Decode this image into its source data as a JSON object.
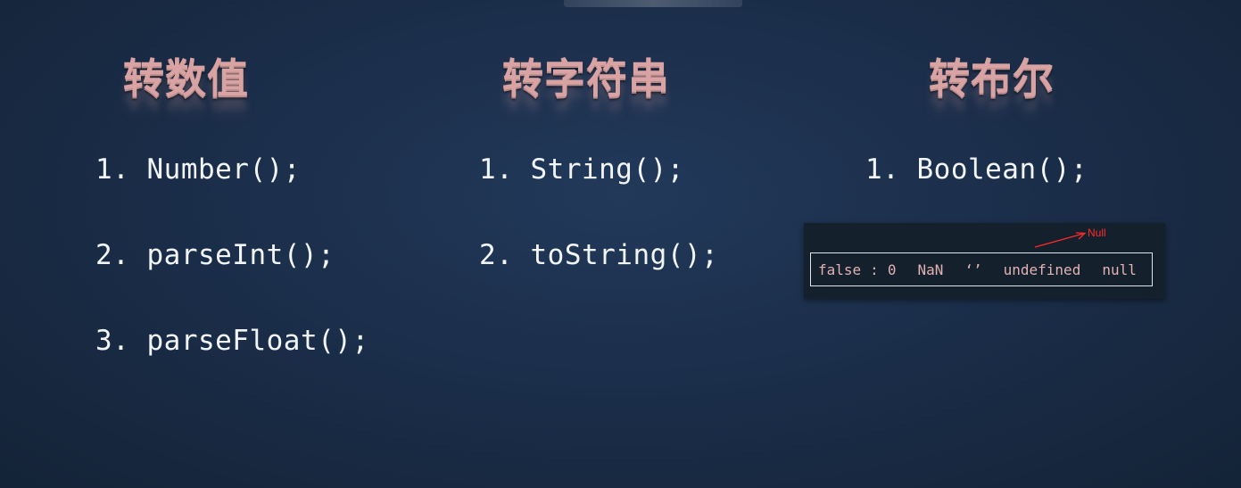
{
  "columns": [
    {
      "title": "转数值",
      "items": [
        "1. Number();",
        "2. parseInt();",
        "3. parseFloat();"
      ]
    },
    {
      "title": "转字符串",
      "items": [
        "1. String();",
        "2. toString();"
      ]
    },
    {
      "title": "转布尔",
      "items": [
        "1. Boolean();"
      ]
    }
  ],
  "falsy_values": {
    "false": "false",
    "colon": ":",
    "zero": "0",
    "nan": "NaN",
    "empty_string": "‘’",
    "undefined": "undefined",
    "null": "null"
  },
  "annotation": {
    "text": "Null",
    "color": "#ff2a2a"
  },
  "colors": {
    "title": "#d9a3a3",
    "code": "#f2f5f8",
    "falsy": "#e0b2b2",
    "background": "#1b2e4a"
  }
}
